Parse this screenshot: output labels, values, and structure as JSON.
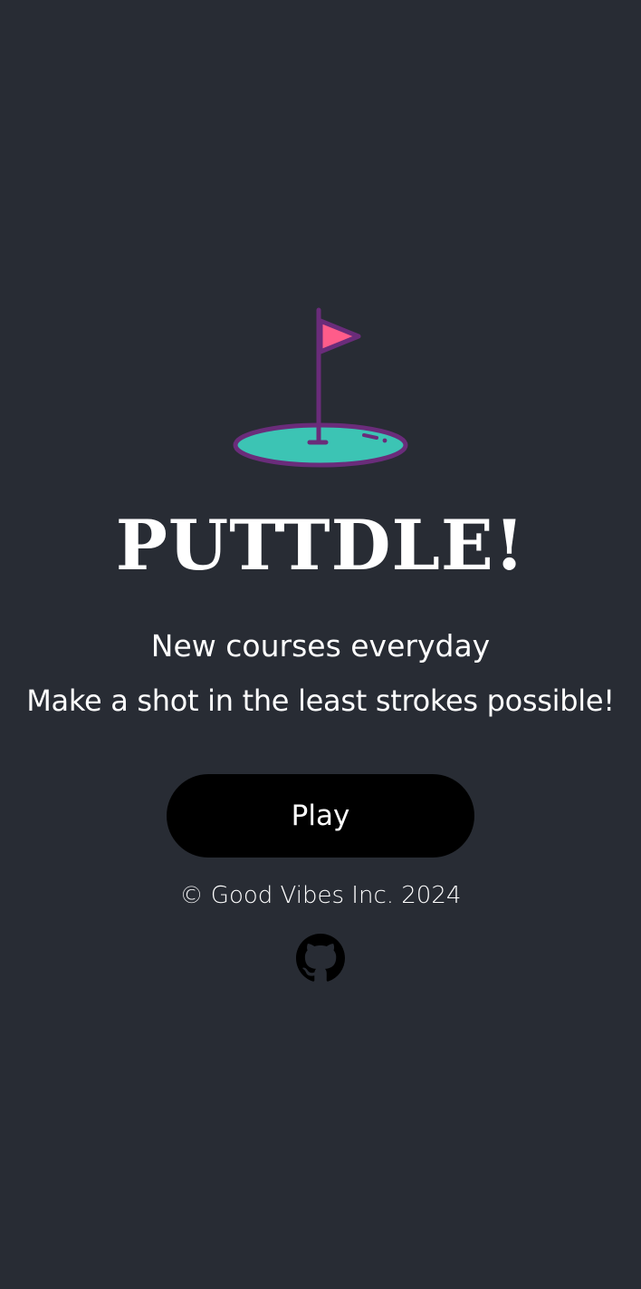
{
  "app": {
    "title": "PUTTDLE!",
    "logo_icon": "golf-flag-icon"
  },
  "taglines": [
    "New courses everyday",
    "Make a shot in the least strokes possible!"
  ],
  "play_button": {
    "label": "Play"
  },
  "footer": {
    "copyright": "© Good Vibes Inc. 2024",
    "github_icon": "github-icon"
  },
  "colors": {
    "background": "#282c34",
    "text": "#ffffff",
    "button_bg": "#000000",
    "flag": "#ff5c8a",
    "green": "#3cc4b4",
    "outline": "#6a2c7a"
  }
}
